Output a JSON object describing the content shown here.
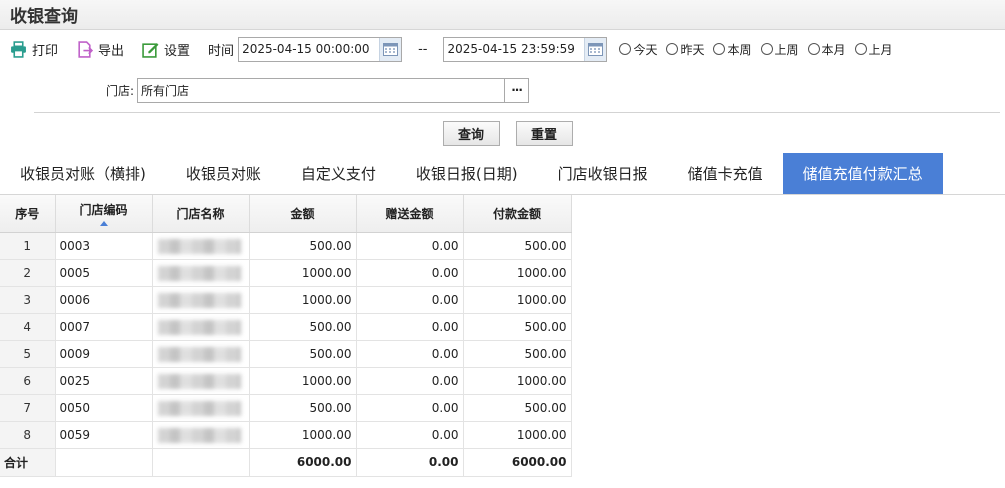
{
  "page": {
    "title": "收银查询"
  },
  "toolbar": {
    "print_label": "打印",
    "export_label": "导出",
    "settings_label": "设置",
    "time_label": "时间",
    "start_time": "2025-04-15 00:00:00",
    "separator": "--",
    "end_time": "2025-04-15 23:59:59",
    "quick_ranges": [
      "今天",
      "昨天",
      "本周",
      "上周",
      "本月",
      "上月"
    ]
  },
  "filter": {
    "store_label": "门店:",
    "store_value": "所有门店",
    "more_label": "···"
  },
  "actions": {
    "query_label": "查询",
    "reset_label": "重置"
  },
  "tabs": [
    {
      "label": "收银员对账（横排)",
      "active": false
    },
    {
      "label": "收银员对账",
      "active": false
    },
    {
      "label": "自定义支付",
      "active": false
    },
    {
      "label": "收银日报(日期)",
      "active": false
    },
    {
      "label": "门店收银日报",
      "active": false
    },
    {
      "label": "储值卡充值",
      "active": false
    },
    {
      "label": "储值充值付款汇总",
      "active": true
    }
  ],
  "grid": {
    "columns": [
      "序号",
      "门店编码",
      "门店名称",
      "金额",
      "赠送金额",
      "付款金额"
    ],
    "rows": [
      {
        "index": "1",
        "code": "0003",
        "amount": "500.00",
        "bonus": "0.00",
        "paid": "500.00"
      },
      {
        "index": "2",
        "code": "0005",
        "amount": "1000.00",
        "bonus": "0.00",
        "paid": "1000.00"
      },
      {
        "index": "3",
        "code": "0006",
        "amount": "1000.00",
        "bonus": "0.00",
        "paid": "1000.00"
      },
      {
        "index": "4",
        "code": "0007",
        "amount": "500.00",
        "bonus": "0.00",
        "paid": "500.00"
      },
      {
        "index": "5",
        "code": "0009",
        "amount": "500.00",
        "bonus": "0.00",
        "paid": "500.00"
      },
      {
        "index": "6",
        "code": "0025",
        "amount": "1000.00",
        "bonus": "0.00",
        "paid": "1000.00"
      },
      {
        "index": "7",
        "code": "0050",
        "amount": "500.00",
        "bonus": "0.00",
        "paid": "500.00"
      },
      {
        "index": "8",
        "code": "0059",
        "amount": "1000.00",
        "bonus": "0.00",
        "paid": "1000.00"
      }
    ],
    "total": {
      "label": "合计",
      "amount": "6000.00",
      "bonus": "0.00",
      "paid": "6000.00"
    }
  },
  "colors": {
    "accent": "#4a7fd6",
    "print_icon": "#2a9d8f",
    "export_icon": "#c062c9",
    "settings_icon": "#3a9a3a"
  }
}
